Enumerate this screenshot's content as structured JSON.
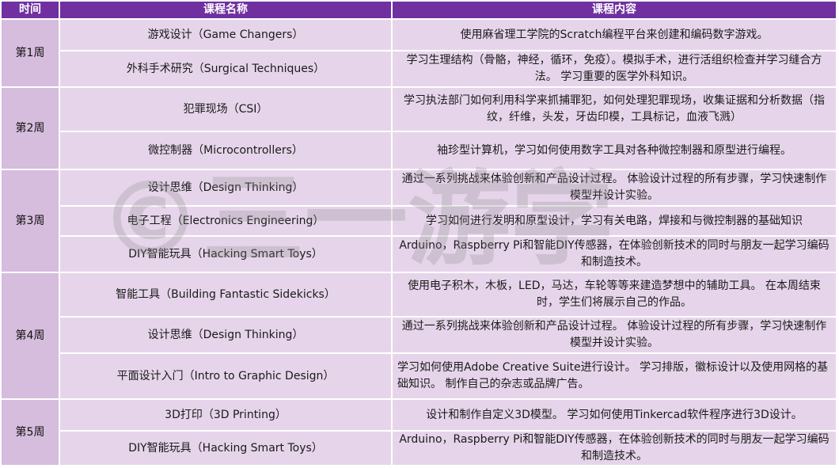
{
  "header": {
    "time": "时间",
    "course_name": "课程名称",
    "course_content": "课程内容"
  },
  "rows": [
    {
      "week": "第1周",
      "name": "游戏设计（Game Changers）",
      "desc": "使用麻省理工学院的Scratch编程平台来创建和编码数字游戏。"
    },
    {
      "name": "外科手术研究（Surgical Techniques）",
      "desc": "学习生理结构（骨骼，神经，循环，免疫）。模拟手术，进行活组织检查并学习缝合方法。 学习重要的医学外科知识。"
    },
    {
      "week": "第2周",
      "name": "犯罪现场（CSI）",
      "desc": "学习执法部门如何利用科学来抓捕罪犯，如何处理犯罪现场，收集证据和分析数据（指纹，纤维，头发，牙齿印模，工具标记，血液飞溅）"
    },
    {
      "name": "微控制器（Microcontrollers）",
      "desc": "袖珍型计算机，学习如何使用数字工具对各种微控制器和原型进行编程。"
    },
    {
      "week": "第3周",
      "name": "设计思维（Design Thinking）",
      "desc": "通过一系列挑战来体验创新和产品设计过程。 体验设计过程的所有步骤，学习快速制作模型并设计实验。"
    },
    {
      "name": "电子工程（Electronics Engineering）",
      "desc": "学习如何进行发明和原型设计，学习有关电路，焊接和与微控制器的基础知识"
    },
    {
      "name": "DIY智能玩具（Hacking Smart Toys）",
      "desc": "Arduino，Raspberry Pi和智能DIY传感器，在体验创新技术的同时与朋友一起学习编码和制造技术。"
    },
    {
      "week": "第4周",
      "name": "智能工具（Building Fantastic Sidekicks）",
      "desc": "使用电子积木，木板，LED，马达，车轮等等来建造梦想中的辅助工具。 在本周结束时，学生们将展示自己的作品。"
    },
    {
      "name": "设计思维（Design Thinking）",
      "desc": "通过一系列挑战来体验创新和产品设计过程。 体验设计过程的所有步骤，学习快速制作模型并设计实验。"
    },
    {
      "name": "平面设计入门（Intro to Graphic Design）",
      "desc": "学习如何使用Adobe Creative Suite进行设计。 学习排版，徽标设计以及使用网格的基础知识。 制作自己的杂志或品牌广告。"
    },
    {
      "week": "第5周",
      "name": "3D打印（3D Printing）",
      "desc": "设计和制作自定义3D模型。 学习如何使用Tinkercad软件程序进行3D设计。"
    },
    {
      "name": "DIY智能玩具（Hacking Smart Toys）",
      "desc": "Arduino，Raspberry Pi和智能DIY传感器，在体验创新技术的同时与朋友一起学习编码和制造技术。"
    }
  ],
  "colors": {
    "header": "#7030a0",
    "week_cell": "#d6bcdd",
    "row_cell": "#e6d5ea"
  },
  "watermark": {
    "text": "©三一游学"
  }
}
